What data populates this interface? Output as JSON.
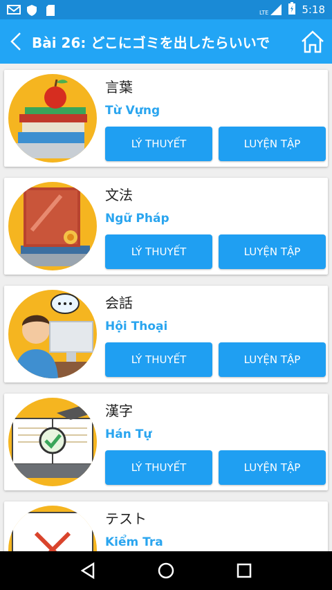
{
  "status_bar": {
    "time": "5:18",
    "network_label": "LTE",
    "left_icons": [
      "gmail-icon",
      "shield-icon",
      "sd-card-icon"
    ],
    "right_icons": [
      "signal-icon",
      "battery-icon"
    ]
  },
  "app_bar": {
    "title": "Bài 26: どこにゴミを出したらいいで",
    "back_icon": "chevron-left-icon",
    "home_icon": "home-icon"
  },
  "sections": [
    {
      "kanji": "言葉",
      "name": "Từ Vựng",
      "image": "books-apple-image",
      "theory_label": "LÝ THUYẾT",
      "practice_label": "LUYỆN TẬP"
    },
    {
      "kanji": "文法",
      "name": "Ngữ Pháp",
      "image": "grammar-book-image",
      "theory_label": "LÝ THUYẾT",
      "practice_label": "LUYỆN TẬP"
    },
    {
      "kanji": "会話",
      "name": "Hội Thoại",
      "image": "conversation-person-image",
      "theory_label": "LÝ THUYẾT",
      "practice_label": "LUYỆN TẬP"
    },
    {
      "kanji": "漢字",
      "name": "Hán Tự",
      "image": "laptop-book-check-image",
      "theory_label": "LÝ THUYẾT",
      "practice_label": "LUYỆN TẬP"
    },
    {
      "kanji": "テスト",
      "name": "Kiểm Tra",
      "image": "test-paper-image",
      "theory_label": "",
      "practice_label": ""
    }
  ],
  "nav_bar": {
    "icons": [
      "back-triangle-icon",
      "home-circle-icon",
      "recents-square-icon"
    ]
  },
  "colors": {
    "status_bar": "#1a8ad6",
    "app_bar": "#22a5f5",
    "button": "#1f9ff2",
    "accent_text": "#2aa5ef",
    "thumb_bg": "#f5b520",
    "background": "#efefef"
  }
}
